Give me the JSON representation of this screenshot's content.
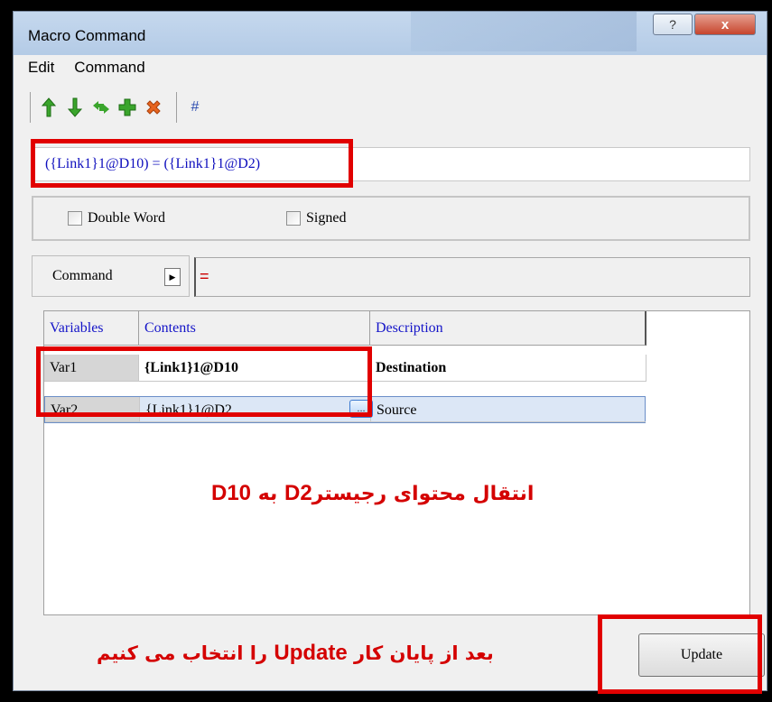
{
  "window": {
    "title": "Macro Command",
    "help_glyph": "?",
    "close_glyph": "x"
  },
  "menu": [
    "Edit",
    "Command"
  ],
  "toolbar": {
    "icons": [
      "arrow-up-icon",
      "arrow-down-icon",
      "swap-icon",
      "add-icon",
      "delete-icon",
      "hash-icon"
    ],
    "hash_label": "#",
    "colors": {
      "green": "#3aa52c",
      "orange": "#e8641e",
      "blue": "#2d4db0"
    }
  },
  "expression": "({Link1}1@D10) = ({Link1}1@D2)",
  "options": {
    "double_word": "Double Word",
    "signed": "Signed"
  },
  "command": {
    "label": "Command",
    "operator": "="
  },
  "table": {
    "headers": [
      "Variables",
      "Contents",
      "Description"
    ],
    "rows": [
      {
        "variable": "Var1",
        "content": "{Link1}1@D10",
        "description": "Destination"
      },
      {
        "variable": "Var2",
        "content": "{Link1}1@D2",
        "description": "Source",
        "button": "..."
      }
    ]
  },
  "annotations": {
    "transfer_text_before": "انتقال محتوای رجیستر",
    "transfer_src": "D2",
    "transfer_mid": "به",
    "transfer_dst": "D10",
    "update_before": "بعد از پایان کار",
    "update_word": "Update",
    "update_after": "را انتخاب می کنیم",
    "color": "#d40000"
  },
  "buttons": {
    "update": "Update"
  }
}
